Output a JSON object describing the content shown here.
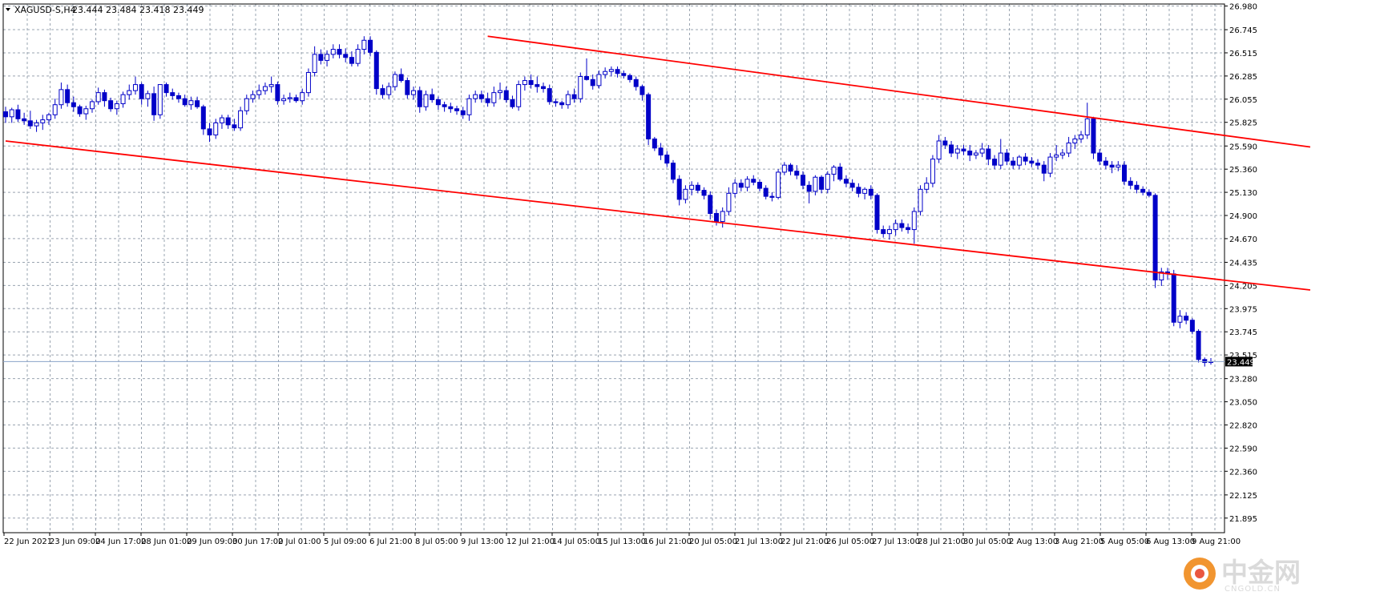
{
  "header": {
    "symbol": "XAGUSD-S,H4",
    "ohlc": "23.444 23.484 23.418 23.449"
  },
  "colors": {
    "candle": "#0000c8",
    "trendline": "#ff0000",
    "grid": "#9aa4b0",
    "background": "#ffffff",
    "price_tag_bg": "#000000",
    "bid_line": "#8aa2c8"
  },
  "watermark": {
    "cn": "中金网",
    "en": "CNGOLD.CN"
  },
  "chart_data": {
    "type": "candlestick",
    "symbol": "XAGUSD-S",
    "timeframe": "H4",
    "ylim": [
      21.75,
      27.0
    ],
    "grid": true,
    "y_ticks": [
      "26.980",
      "26.745",
      "26.515",
      "26.285",
      "26.055",
      "25.825",
      "25.590",
      "25.360",
      "25.130",
      "24.900",
      "24.670",
      "24.435",
      "24.205",
      "23.975",
      "23.745",
      "23.515",
      "23.280",
      "23.050",
      "22.820",
      "22.590",
      "22.360",
      "22.125",
      "21.895"
    ],
    "x_labels": [
      "22 Jun 2021",
      "23 Jun 09:00",
      "24 Jun 17:00",
      "28 Jun 01:00",
      "29 Jun 09:00",
      "30 Jun 17:00",
      "2 Jul 01:00",
      "5 Jul 09:00",
      "6 Jul 21:00",
      "8 Jul 05:00",
      "9 Jul 13:00",
      "12 Jul 21:00",
      "14 Jul 05:00",
      "15 Jul 13:00",
      "16 Jul 21:00",
      "20 Jul 05:00",
      "21 Jul 13:00",
      "22 Jul 21:00",
      "26 Jul 05:00",
      "27 Jul 13:00",
      "28 Jul 21:00",
      "30 Jul 05:00",
      "2 Aug 13:00",
      "3 Aug 21:00",
      "5 Aug 05:00",
      "6 Aug 13:00",
      "9 Aug 21:00"
    ],
    "current_price": "23.449",
    "current_value": 23.449,
    "candles": [
      [
        25.93,
        25.98,
        25.82,
        25.88
      ],
      [
        25.88,
        25.97,
        25.82,
        25.95
      ],
      [
        25.95,
        26.0,
        25.83,
        25.86
      ],
      [
        25.86,
        25.92,
        25.8,
        25.84
      ],
      [
        25.84,
        25.94,
        25.76,
        25.79
      ],
      [
        25.79,
        25.85,
        25.73,
        25.82
      ],
      [
        25.82,
        25.9,
        25.75,
        25.85
      ],
      [
        25.85,
        25.92,
        25.8,
        25.9
      ],
      [
        25.9,
        26.06,
        25.86,
        26.0
      ],
      [
        26.0,
        26.22,
        25.96,
        26.15
      ],
      [
        26.15,
        26.2,
        25.98,
        26.02
      ],
      [
        26.02,
        26.08,
        25.93,
        25.98
      ],
      [
        25.98,
        26.0,
        25.88,
        25.91
      ],
      [
        25.91,
        25.99,
        25.85,
        25.96
      ],
      [
        25.96,
        26.05,
        25.92,
        26.03
      ],
      [
        26.03,
        26.17,
        26.0,
        26.12
      ],
      [
        26.12,
        26.15,
        25.98,
        26.04
      ],
      [
        26.04,
        26.07,
        25.93,
        25.96
      ],
      [
        25.96,
        26.04,
        25.9,
        26.01
      ],
      [
        26.01,
        26.13,
        25.97,
        26.1
      ],
      [
        26.1,
        26.2,
        26.05,
        26.14
      ],
      [
        26.14,
        26.28,
        26.1,
        26.2
      ],
      [
        26.2,
        26.22,
        26.0,
        26.06
      ],
      [
        26.06,
        26.14,
        25.98,
        26.11
      ],
      [
        26.11,
        26.18,
        25.84,
        25.9
      ],
      [
        25.9,
        26.15,
        25.86,
        26.2
      ],
      [
        26.2,
        26.22,
        26.08,
        26.12
      ],
      [
        26.12,
        26.16,
        26.05,
        26.09
      ],
      [
        26.09,
        26.12,
        26.02,
        26.06
      ],
      [
        26.06,
        26.1,
        25.98,
        26.0
      ],
      [
        26.0,
        26.08,
        25.95,
        26.04
      ],
      [
        26.04,
        26.08,
        25.96,
        25.98
      ],
      [
        25.98,
        26.0,
        25.7,
        25.76
      ],
      [
        25.76,
        25.82,
        25.63,
        25.7
      ],
      [
        25.7,
        25.86,
        25.66,
        25.82
      ],
      [
        25.82,
        25.9,
        25.76,
        25.87
      ],
      [
        25.87,
        25.9,
        25.76,
        25.8
      ],
      [
        25.8,
        25.86,
        25.74,
        25.77
      ],
      [
        25.77,
        25.98,
        25.74,
        25.94
      ],
      [
        25.94,
        26.1,
        25.9,
        26.06
      ],
      [
        26.06,
        26.14,
        26.02,
        26.1
      ],
      [
        26.1,
        26.2,
        26.06,
        26.14
      ],
      [
        26.14,
        26.22,
        26.1,
        26.18
      ],
      [
        26.18,
        26.28,
        26.12,
        26.2
      ],
      [
        26.2,
        26.23,
        26.0,
        26.04
      ],
      [
        26.04,
        26.1,
        26.0,
        26.06
      ],
      [
        26.06,
        26.12,
        26.02,
        26.07
      ],
      [
        26.07,
        26.1,
        26.02,
        26.04
      ],
      [
        26.04,
        26.16,
        26.0,
        26.12
      ],
      [
        26.12,
        26.36,
        26.08,
        26.32
      ],
      [
        26.32,
        26.58,
        26.28,
        26.5
      ],
      [
        26.5,
        26.55,
        26.4,
        26.44
      ],
      [
        26.44,
        26.54,
        26.38,
        26.5
      ],
      [
        26.5,
        26.6,
        26.46,
        26.55
      ],
      [
        26.55,
        26.6,
        26.46,
        26.5
      ],
      [
        26.5,
        26.56,
        26.42,
        26.47
      ],
      [
        26.47,
        26.53,
        26.38,
        26.41
      ],
      [
        26.41,
        26.6,
        26.38,
        26.55
      ],
      [
        26.55,
        26.68,
        26.5,
        26.64
      ],
      [
        26.64,
        26.68,
        26.48,
        26.52
      ],
      [
        26.52,
        26.54,
        26.1,
        26.16
      ],
      [
        26.16,
        26.2,
        26.06,
        26.1
      ],
      [
        26.1,
        26.22,
        26.06,
        26.18
      ],
      [
        26.18,
        26.33,
        26.14,
        26.3
      ],
      [
        26.3,
        26.36,
        26.22,
        26.24
      ],
      [
        26.24,
        26.27,
        26.06,
        26.1
      ],
      [
        26.1,
        26.18,
        26.05,
        26.14
      ],
      [
        26.14,
        26.18,
        25.92,
        25.98
      ],
      [
        25.98,
        26.14,
        25.94,
        26.1
      ],
      [
        26.1,
        26.16,
        26.02,
        26.05
      ],
      [
        26.05,
        26.08,
        25.95,
        26.0
      ],
      [
        26.0,
        26.03,
        25.93,
        25.98
      ],
      [
        25.98,
        26.02,
        25.92,
        25.96
      ],
      [
        25.96,
        25.99,
        25.9,
        25.94
      ],
      [
        25.94,
        25.98,
        25.86,
        25.9
      ],
      [
        25.9,
        26.1,
        25.84,
        26.06
      ],
      [
        26.06,
        26.14,
        26.02,
        26.1
      ],
      [
        26.1,
        26.14,
        26.02,
        26.06
      ],
      [
        26.06,
        26.12,
        25.98,
        26.02
      ],
      [
        26.02,
        26.18,
        25.98,
        26.12
      ],
      [
        26.12,
        26.22,
        26.06,
        26.14
      ],
      [
        26.14,
        26.18,
        26.02,
        26.05
      ],
      [
        26.05,
        26.09,
        25.96,
        25.98
      ],
      [
        25.98,
        26.24,
        25.94,
        26.2
      ],
      [
        26.2,
        26.28,
        26.14,
        26.24
      ],
      [
        26.24,
        26.3,
        26.16,
        26.2
      ],
      [
        26.2,
        26.28,
        26.12,
        26.18
      ],
      [
        26.18,
        26.22,
        26.12,
        26.16
      ],
      [
        26.16,
        26.2,
        26.0,
        26.03
      ],
      [
        26.03,
        26.06,
        25.98,
        26.02
      ],
      [
        26.02,
        26.04,
        25.96,
        26.0
      ],
      [
        26.0,
        26.14,
        25.96,
        26.1
      ],
      [
        26.1,
        26.16,
        26.02,
        26.06
      ],
      [
        26.06,
        26.32,
        26.02,
        26.28
      ],
      [
        26.28,
        26.46,
        26.24,
        26.25
      ],
      [
        26.25,
        26.3,
        26.15,
        26.19
      ],
      [
        26.19,
        26.34,
        26.16,
        26.3
      ],
      [
        26.3,
        26.37,
        26.26,
        26.33
      ],
      [
        26.33,
        26.38,
        26.28,
        26.35
      ],
      [
        26.35,
        26.38,
        26.27,
        26.31
      ],
      [
        26.31,
        26.34,
        26.26,
        26.29
      ],
      [
        26.29,
        26.31,
        26.22,
        26.25
      ],
      [
        26.25,
        26.28,
        26.14,
        26.18
      ],
      [
        26.18,
        26.2,
        26.04,
        26.1
      ],
      [
        26.1,
        26.12,
        25.6,
        25.66
      ],
      [
        25.66,
        25.68,
        25.54,
        25.57
      ],
      [
        25.57,
        25.62,
        25.45,
        25.5
      ],
      [
        25.5,
        25.54,
        25.38,
        25.42
      ],
      [
        25.42,
        25.45,
        25.22,
        25.26
      ],
      [
        25.26,
        25.3,
        25.0,
        25.06
      ],
      [
        25.06,
        25.2,
        25.02,
        25.16
      ],
      [
        25.16,
        25.24,
        25.1,
        25.2
      ],
      [
        25.2,
        25.23,
        25.12,
        25.15
      ],
      [
        25.15,
        25.18,
        25.06,
        25.1
      ],
      [
        25.1,
        25.14,
        24.86,
        24.92
      ],
      [
        24.92,
        24.96,
        24.8,
        24.84
      ],
      [
        24.84,
        24.98,
        24.78,
        24.94
      ],
      [
        24.94,
        25.18,
        24.9,
        25.12
      ],
      [
        25.12,
        25.26,
        25.08,
        25.22
      ],
      [
        25.22,
        25.26,
        25.14,
        25.18
      ],
      [
        25.18,
        25.29,
        25.14,
        25.26
      ],
      [
        25.26,
        25.3,
        25.2,
        25.23
      ],
      [
        25.23,
        25.26,
        25.14,
        25.17
      ],
      [
        25.17,
        25.2,
        25.06,
        25.09
      ],
      [
        25.09,
        25.13,
        25.04,
        25.08
      ],
      [
        25.08,
        25.36,
        25.06,
        25.33
      ],
      [
        25.33,
        25.43,
        25.3,
        25.4
      ],
      [
        25.4,
        25.42,
        25.3,
        25.34
      ],
      [
        25.34,
        25.4,
        25.26,
        25.3
      ],
      [
        25.3,
        25.34,
        25.16,
        25.2
      ],
      [
        25.2,
        25.24,
        25.02,
        25.14
      ],
      [
        25.14,
        25.3,
        25.1,
        25.28
      ],
      [
        25.28,
        25.3,
        25.12,
        25.16
      ],
      [
        25.16,
        25.34,
        25.12,
        25.31
      ],
      [
        25.31,
        25.4,
        25.24,
        25.38
      ],
      [
        25.38,
        25.42,
        25.24,
        25.26
      ],
      [
        25.26,
        25.3,
        25.18,
        25.22
      ],
      [
        25.22,
        25.26,
        25.14,
        25.18
      ],
      [
        25.18,
        25.22,
        25.08,
        25.12
      ],
      [
        25.12,
        25.18,
        25.06,
        25.16
      ],
      [
        25.16,
        25.2,
        25.06,
        25.1
      ],
      [
        25.1,
        25.12,
        24.72,
        24.76
      ],
      [
        24.76,
        24.8,
        24.68,
        24.72
      ],
      [
        24.72,
        24.8,
        24.66,
        24.76
      ],
      [
        24.76,
        24.86,
        24.7,
        24.82
      ],
      [
        24.82,
        24.86,
        24.74,
        24.78
      ],
      [
        24.78,
        24.82,
        24.72,
        24.76
      ],
      [
        24.76,
        24.98,
        24.62,
        24.94
      ],
      [
        24.94,
        25.2,
        24.9,
        25.16
      ],
      [
        25.16,
        25.28,
        25.12,
        25.22
      ],
      [
        25.22,
        25.5,
        25.18,
        25.46
      ],
      [
        25.46,
        25.7,
        25.42,
        25.64
      ],
      [
        25.64,
        25.68,
        25.56,
        25.6
      ],
      [
        25.6,
        25.64,
        25.48,
        25.52
      ],
      [
        25.52,
        25.6,
        25.46,
        25.56
      ],
      [
        25.56,
        25.6,
        25.5,
        25.54
      ],
      [
        25.54,
        25.6,
        25.44,
        25.5
      ],
      [
        25.5,
        25.55,
        25.46,
        25.52
      ],
      [
        25.52,
        25.62,
        25.48,
        25.56
      ],
      [
        25.56,
        25.6,
        25.4,
        25.46
      ],
      [
        25.46,
        25.5,
        25.36,
        25.4
      ],
      [
        25.4,
        25.66,
        25.36,
        25.52
      ],
      [
        25.52,
        25.56,
        25.4,
        25.44
      ],
      [
        25.44,
        25.48,
        25.36,
        25.4
      ],
      [
        25.4,
        25.5,
        25.36,
        25.48
      ],
      [
        25.48,
        25.52,
        25.4,
        25.44
      ],
      [
        25.44,
        25.48,
        25.38,
        25.42
      ],
      [
        25.42,
        25.46,
        25.36,
        25.4
      ],
      [
        25.4,
        25.44,
        25.24,
        25.32
      ],
      [
        25.32,
        25.52,
        25.28,
        25.48
      ],
      [
        25.48,
        25.6,
        25.44,
        25.5
      ],
      [
        25.5,
        25.56,
        25.46,
        25.52
      ],
      [
        25.52,
        25.68,
        25.48,
        25.62
      ],
      [
        25.62,
        25.7,
        25.56,
        25.66
      ],
      [
        25.66,
        25.74,
        25.62,
        25.7
      ],
      [
        25.7,
        26.02,
        25.66,
        25.86
      ],
      [
        25.86,
        25.88,
        25.46,
        25.52
      ],
      [
        25.52,
        25.56,
        25.4,
        25.44
      ],
      [
        25.44,
        25.48,
        25.36,
        25.4
      ],
      [
        25.4,
        25.44,
        25.32,
        25.38
      ],
      [
        25.38,
        25.44,
        25.34,
        25.4
      ],
      [
        25.4,
        25.44,
        25.2,
        25.24
      ],
      [
        25.24,
        25.28,
        25.16,
        25.2
      ],
      [
        25.2,
        25.24,
        25.12,
        25.16
      ],
      [
        25.16,
        25.19,
        25.1,
        25.13
      ],
      [
        25.13,
        25.16,
        25.08,
        25.1
      ],
      [
        25.1,
        25.12,
        24.18,
        24.26
      ],
      [
        24.26,
        24.38,
        24.2,
        24.34
      ],
      [
        24.34,
        24.38,
        24.26,
        24.32
      ],
      [
        24.32,
        24.36,
        23.8,
        23.84
      ],
      [
        23.84,
        23.96,
        23.78,
        23.9
      ],
      [
        23.9,
        23.94,
        23.82,
        23.86
      ],
      [
        23.86,
        23.88,
        23.72,
        23.75
      ],
      [
        23.75,
        23.77,
        23.44,
        23.47
      ],
      [
        23.47,
        23.49,
        23.4,
        23.44
      ],
      [
        23.44,
        23.484,
        23.418,
        23.449
      ]
    ],
    "trendlines": [
      {
        "name": "",
        "points": [
          [
            78,
            26.68
          ],
          [
            209,
            25.58
          ]
        ]
      },
      {
        "name": "",
        "points": [
          [
            0,
            25.64
          ],
          [
            209,
            24.16
          ]
        ]
      }
    ]
  }
}
